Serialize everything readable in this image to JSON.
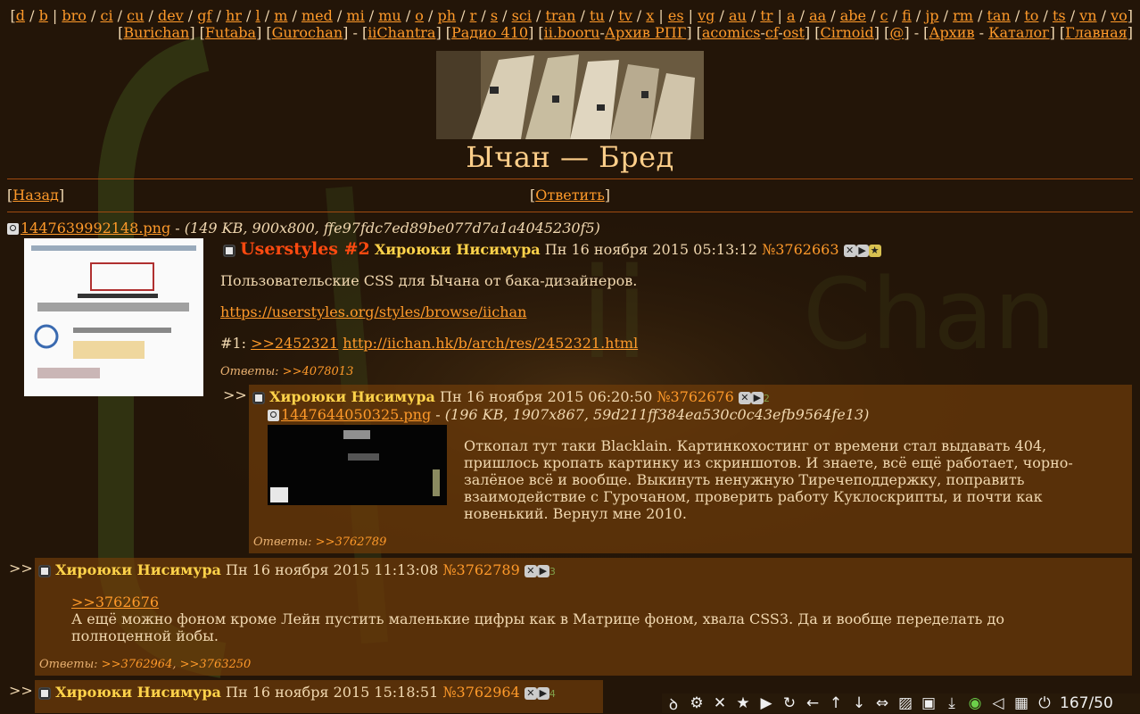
{
  "nav_boards": [
    "d",
    "b",
    "bro",
    "ci",
    "cu",
    "dev",
    "gf",
    "hr",
    "l",
    "m",
    "med",
    "mi",
    "mu",
    "o",
    "ph",
    "r",
    "s",
    "sci",
    "tran",
    "tu",
    "tv",
    "x",
    "es",
    "vg",
    "au",
    "tr",
    "a",
    "aa",
    "abe",
    "c",
    "fi",
    "jp",
    "rm",
    "tan",
    "to",
    "ts",
    "vn",
    "vo"
  ],
  "nav_links": [
    "Burichan",
    "Futaba",
    "Gurochan",
    "iiChantra",
    "Радио 410",
    "ii.booru",
    "Архив РПГ",
    "acomics",
    "cf",
    "ost",
    "Cirnoid",
    "@",
    "Архив",
    "Каталог",
    "Главная"
  ],
  "page_title": "Ычан — Бред",
  "nav": {
    "back": "Назад",
    "reply": "Ответить"
  },
  "op": {
    "file_name": "1447639992148.png",
    "file_meta": "(149 KB, 900x800, ffe97fdc7ed89be077d7a1a4045230f5)",
    "subject": "Userstyles #2",
    "poster": "Хироюки Нисимура",
    "date": "Пн 16 ноября 2015 05:13:12",
    "number": "№3762663",
    "line1": "Пользовательские CSS для Ычана от бака-дизайнеров.",
    "link1": "https://userstyles.org/styles/browse/iichan",
    "line3_prefix": "#1: ",
    "ref": ">>2452321",
    "link2": "http://iichan.hk/b/arch/res/2452321.html",
    "replies_label": "Ответы: ",
    "replies": ">>4078013"
  },
  "reply1": {
    "poster": "Хироюки Нисимура",
    "date": "Пн 16 ноября 2015 06:20:50",
    "number": "№3762676",
    "count": "2",
    "file_name": "1447644050325.png",
    "file_meta": "(196 KB, 1907x867, 59d211ff384ea530c0c43efb9564fe13)",
    "text": "Откопал тут таки Blacklain. Картинкохостинг от времени стал выдавать 404, пришлось кропать картинку из скриншотов. И знаете, всё ещё работает, чорно-залёное всё и вообще. Выкинуть ненужную Тиречеподдержку, поправить взаимодействие с Гурочаном, проверить работу Куклоскрипты, и почти как новенький. Вернул мне 2010.",
    "replies_label": "Ответы: ",
    "replies": ">>3762789"
  },
  "reply2": {
    "poster": "Хироюки Нисимура",
    "date": "Пн 16 ноября 2015 11:13:08",
    "number": "№3762789",
    "count": "3",
    "ref": ">>3762676",
    "text": "А ещё можно фоном кроме Лейн пустить маленькие цифры как в Матрице фоном, хвала CSS3. Да и вообще переделать до полноценной йобы.",
    "replies_label": "Ответы: ",
    "replies_1": ">>3762964",
    "replies_2": ">>3763250"
  },
  "reply3": {
    "poster": "Хироюки Нисимура",
    "date": "Пн 16 ноября 2015 15:18:51",
    "number": "№3762964",
    "count": "4"
  },
  "reply_marker": ">>",
  "toolbar": {
    "icons": [
      "logo-icon",
      "gear-icon",
      "close-icon",
      "star-icon",
      "play-icon",
      "refresh-icon",
      "arrow-left-icon",
      "arrow-up-icon",
      "arrow-down-icon",
      "expand-icon",
      "image-icon",
      "save-icon",
      "download-icon",
      "eye-icon",
      "mute-icon",
      "grid-icon",
      "power-icon"
    ],
    "counter": "167/50"
  },
  "colors": {
    "background": "#231508",
    "link": "#ff9a2a",
    "subject": "#ff4a10",
    "poster": "#ffd34a",
    "reply_bg": "#6e3c0a"
  }
}
